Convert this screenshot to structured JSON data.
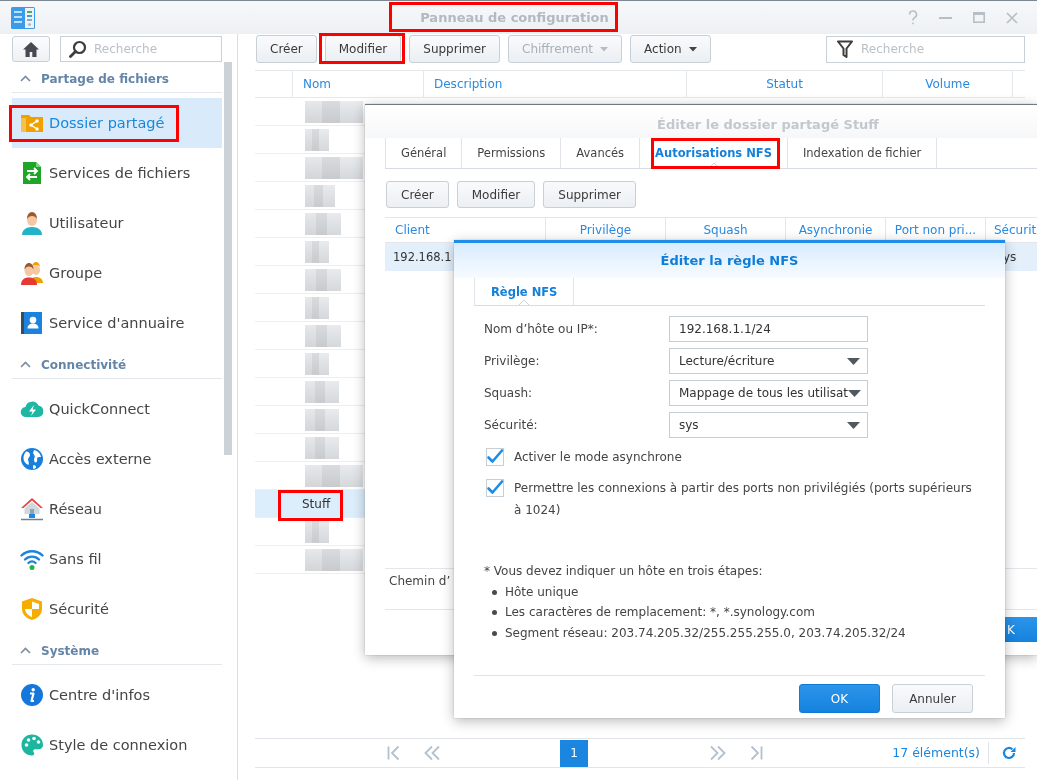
{
  "window": {
    "title": "Panneau de configuration",
    "highlighted": true
  },
  "sidebar": {
    "search": {
      "placeholder": "Recherche"
    },
    "sections": [
      {
        "title": "Partage de fichiers",
        "expanded": true,
        "items": [
          {
            "label": "Dossier partagé",
            "selected": true,
            "highlighted": true
          },
          {
            "label": "Services de fichiers",
            "selected": false,
            "highlighted": false
          },
          {
            "label": "Utilisateur",
            "selected": false,
            "highlighted": false
          },
          {
            "label": "Groupe",
            "selected": false,
            "highlighted": false
          },
          {
            "label": "Service d'annuaire",
            "selected": false,
            "highlighted": false
          }
        ]
      },
      {
        "title": "Connectivité",
        "expanded": true,
        "items": [
          {
            "label": "QuickConnect",
            "selected": false,
            "highlighted": false
          },
          {
            "label": "Accès externe",
            "selected": false,
            "highlighted": false
          },
          {
            "label": "Réseau",
            "selected": false,
            "highlighted": false
          },
          {
            "label": "Sans fil",
            "selected": false,
            "highlighted": false
          },
          {
            "label": "Sécurité",
            "selected": false,
            "highlighted": false
          }
        ]
      },
      {
        "title": "Système",
        "expanded": true,
        "items": [
          {
            "label": "Centre d'infos",
            "selected": false,
            "highlighted": false
          },
          {
            "label": "Style de connexion",
            "selected": false,
            "highlighted": false
          }
        ]
      }
    ]
  },
  "toolbar": {
    "buttons": [
      {
        "label": "Créer",
        "kind": "plain",
        "disabled": false,
        "highlighted": false
      },
      {
        "label": "Modifier",
        "kind": "plain",
        "disabled": false,
        "highlighted": true
      },
      {
        "label": "Supprimer",
        "kind": "plain",
        "disabled": false,
        "highlighted": false
      },
      {
        "label": "Chiffrement",
        "kind": "menu",
        "disabled": true,
        "highlighted": false
      },
      {
        "label": "Action",
        "kind": "menu",
        "disabled": false,
        "highlighted": false
      }
    ],
    "filter": {
      "placeholder": "Recherche"
    }
  },
  "table": {
    "columns": [
      "Nom",
      "Description",
      "Statut",
      "Volume"
    ],
    "rows": [
      {
        "kind": "blurred",
        "selected": false
      },
      {
        "kind": "blurred",
        "selected": false
      },
      {
        "kind": "blurred",
        "selected": false
      },
      {
        "kind": "blurred",
        "selected": false
      },
      {
        "kind": "blurred",
        "selected": false
      },
      {
        "kind": "blurred",
        "selected": false
      },
      {
        "kind": "blurred",
        "selected": false
      },
      {
        "kind": "blurred",
        "selected": false
      },
      {
        "kind": "blurred",
        "selected": false
      },
      {
        "kind": "blurred",
        "selected": false
      },
      {
        "kind": "blurred",
        "selected": false
      },
      {
        "kind": "blurred",
        "selected": false
      },
      {
        "kind": "blurred",
        "selected": false
      },
      {
        "kind": "blurred",
        "selected": false
      },
      {
        "kind": "named",
        "name": "Stuff",
        "selected": true,
        "highlighted": true
      },
      {
        "kind": "blurred",
        "selected": false
      },
      {
        "kind": "blurred",
        "selected": false
      }
    ]
  },
  "pager": {
    "back": [
      {
        "kind": "first",
        "disabled": true
      },
      {
        "kind": "previous",
        "disabled": true
      }
    ],
    "pages": [
      {
        "label": "1",
        "selected": true
      }
    ],
    "forward": [
      {
        "kind": "next",
        "disabled": true
      },
      {
        "kind": "last",
        "disabled": true
      }
    ],
    "count": "17 élément(s)"
  },
  "share_dialog": {
    "title": "Éditer le dossier partagé Stuff",
    "tabs": [
      {
        "label": "Général",
        "selected": false,
        "highlighted": false
      },
      {
        "label": "Permissions",
        "selected": false,
        "highlighted": false
      },
      {
        "label": "Avancés",
        "selected": false,
        "highlighted": false
      },
      {
        "label": "Autorisations NFS",
        "selected": true,
        "highlighted": true
      },
      {
        "label": "Indexation de fichier",
        "selected": false,
        "highlighted": false
      }
    ],
    "buttons": [
      "Créer",
      "Modifier",
      "Supprimer"
    ],
    "table": {
      "columns": [
        "Client",
        "Privilège",
        "Squash",
        "Asynchronie",
        "Port non pri...",
        "Sécurit"
      ],
      "rows": [
        {
          "selected": true,
          "client": "192.168.1",
          "security": "ys"
        }
      ]
    },
    "path_label": "Chemin d’",
    "footer_button": {
      "label": "K",
      "kind": "primary"
    }
  },
  "nfs_dialog": {
    "title": "Éditer la règle NFS",
    "tabs": [
      {
        "label": "Règle NFS",
        "selected": true
      }
    ],
    "fields": [
      {
        "kind": "text",
        "label": "Nom d’hôte ou IP*:",
        "value": "192.168.1.1/24"
      },
      {
        "kind": "select",
        "label": "Privilège:",
        "value": "Lecture/écriture"
      },
      {
        "kind": "select",
        "label": "Squash:",
        "value": "Mappage de tous les utilisat"
      },
      {
        "kind": "select",
        "label": "Sécurité:",
        "value": "sys"
      }
    ],
    "checkboxes": [
      {
        "label": "Activer le mode asynchrone",
        "checked": true
      },
      {
        "label": "Permettre les connexions à partir des ports non privilégiés (ports supérieurs à 1024)",
        "checked": true
      }
    ],
    "note": {
      "text": "* Vous devez indiquer un hôte en trois étapes:",
      "items": [
        "Hôte unique",
        "Les caractères de remplacement: *, *.synology.com",
        "Segment réseau: 203.74.205.32/255.255.255.0, 203.74.205.32/24"
      ]
    },
    "buttons": [
      {
        "label": "OK",
        "kind": "primary"
      },
      {
        "label": "Annuler",
        "kind": "secondary"
      }
    ]
  }
}
